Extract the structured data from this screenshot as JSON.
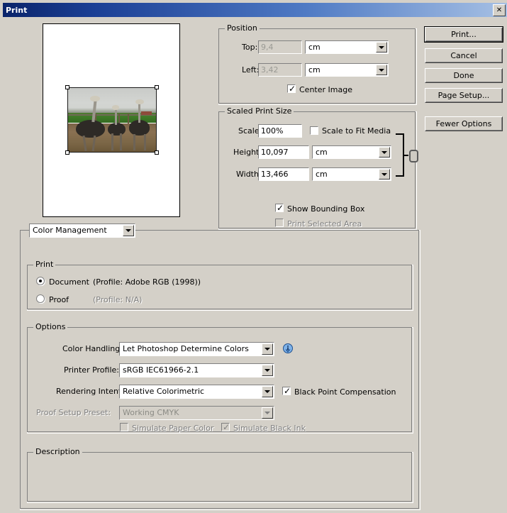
{
  "window": {
    "title": "Print",
    "close_label": "✕"
  },
  "buttons": {
    "print": "Print...",
    "cancel": "Cancel",
    "done": "Done",
    "page_setup": "Page Setup...",
    "fewer_options": "Fewer Options"
  },
  "position": {
    "legend": "Position",
    "top_label": "Top:",
    "top_value": "9,4",
    "top_unit": "cm",
    "left_label": "Left:",
    "left_value": "3,42",
    "left_unit": "cm",
    "center_image_label": "Center Image",
    "center_image_checked": true
  },
  "scaled_print_size": {
    "legend": "Scaled Print Size",
    "scale_label": "Scale:",
    "scale_value": "100%",
    "scale_to_fit_label": "Scale to Fit Media",
    "scale_to_fit_checked": false,
    "height_label": "Height:",
    "height_value": "10,097",
    "height_unit": "cm",
    "width_label": "Width:",
    "width_value": "13,466",
    "width_unit": "cm",
    "link_icon": "chain-link-icon",
    "show_bounding_box_label": "Show Bounding Box",
    "show_bounding_box_checked": true,
    "print_selected_area_label": "Print Selected Area",
    "print_selected_area_checked": false,
    "print_selected_area_enabled": false
  },
  "section_selector": {
    "value": "Color Management"
  },
  "print_group": {
    "legend": "Print",
    "document_label": "Document",
    "document_profile": "(Profile: Adobe RGB (1998))",
    "document_selected": true,
    "proof_label": "Proof",
    "proof_profile": "(Profile: N/A)",
    "proof_selected": false
  },
  "options": {
    "legend": "Options",
    "color_handling_label": "Color Handling:",
    "color_handling_value": "Let Photoshop Determine Colors",
    "info_icon": "info-icon",
    "printer_profile_label": "Printer Profile:",
    "printer_profile_value": "sRGB IEC61966-2.1",
    "rendering_intent_label": "Rendering Intent:",
    "rendering_intent_value": "Relative Colorimetric",
    "black_point_label": "Black Point Compensation",
    "black_point_checked": true,
    "proof_setup_label": "Proof Setup Preset:",
    "proof_setup_value": "Working CMYK",
    "proof_setup_enabled": false,
    "simulate_paper_label": "Simulate Paper Color",
    "simulate_paper_checked": false,
    "simulate_black_label": "Simulate Black Ink",
    "simulate_black_checked": true
  },
  "description": {
    "legend": "Description",
    "text": ""
  },
  "preview": {
    "name": "print-preview",
    "image_subject": "three ostriches in a farm paddock",
    "bounding_box_visible": true
  },
  "colors": {
    "dialog_face": "#d4d0c8",
    "title_active_left": "#0a246a",
    "title_active_right": "#a6c0e4",
    "field_bg": "#ffffff",
    "disabled_text": "#808080",
    "info_blue": "#2f6fc0"
  }
}
